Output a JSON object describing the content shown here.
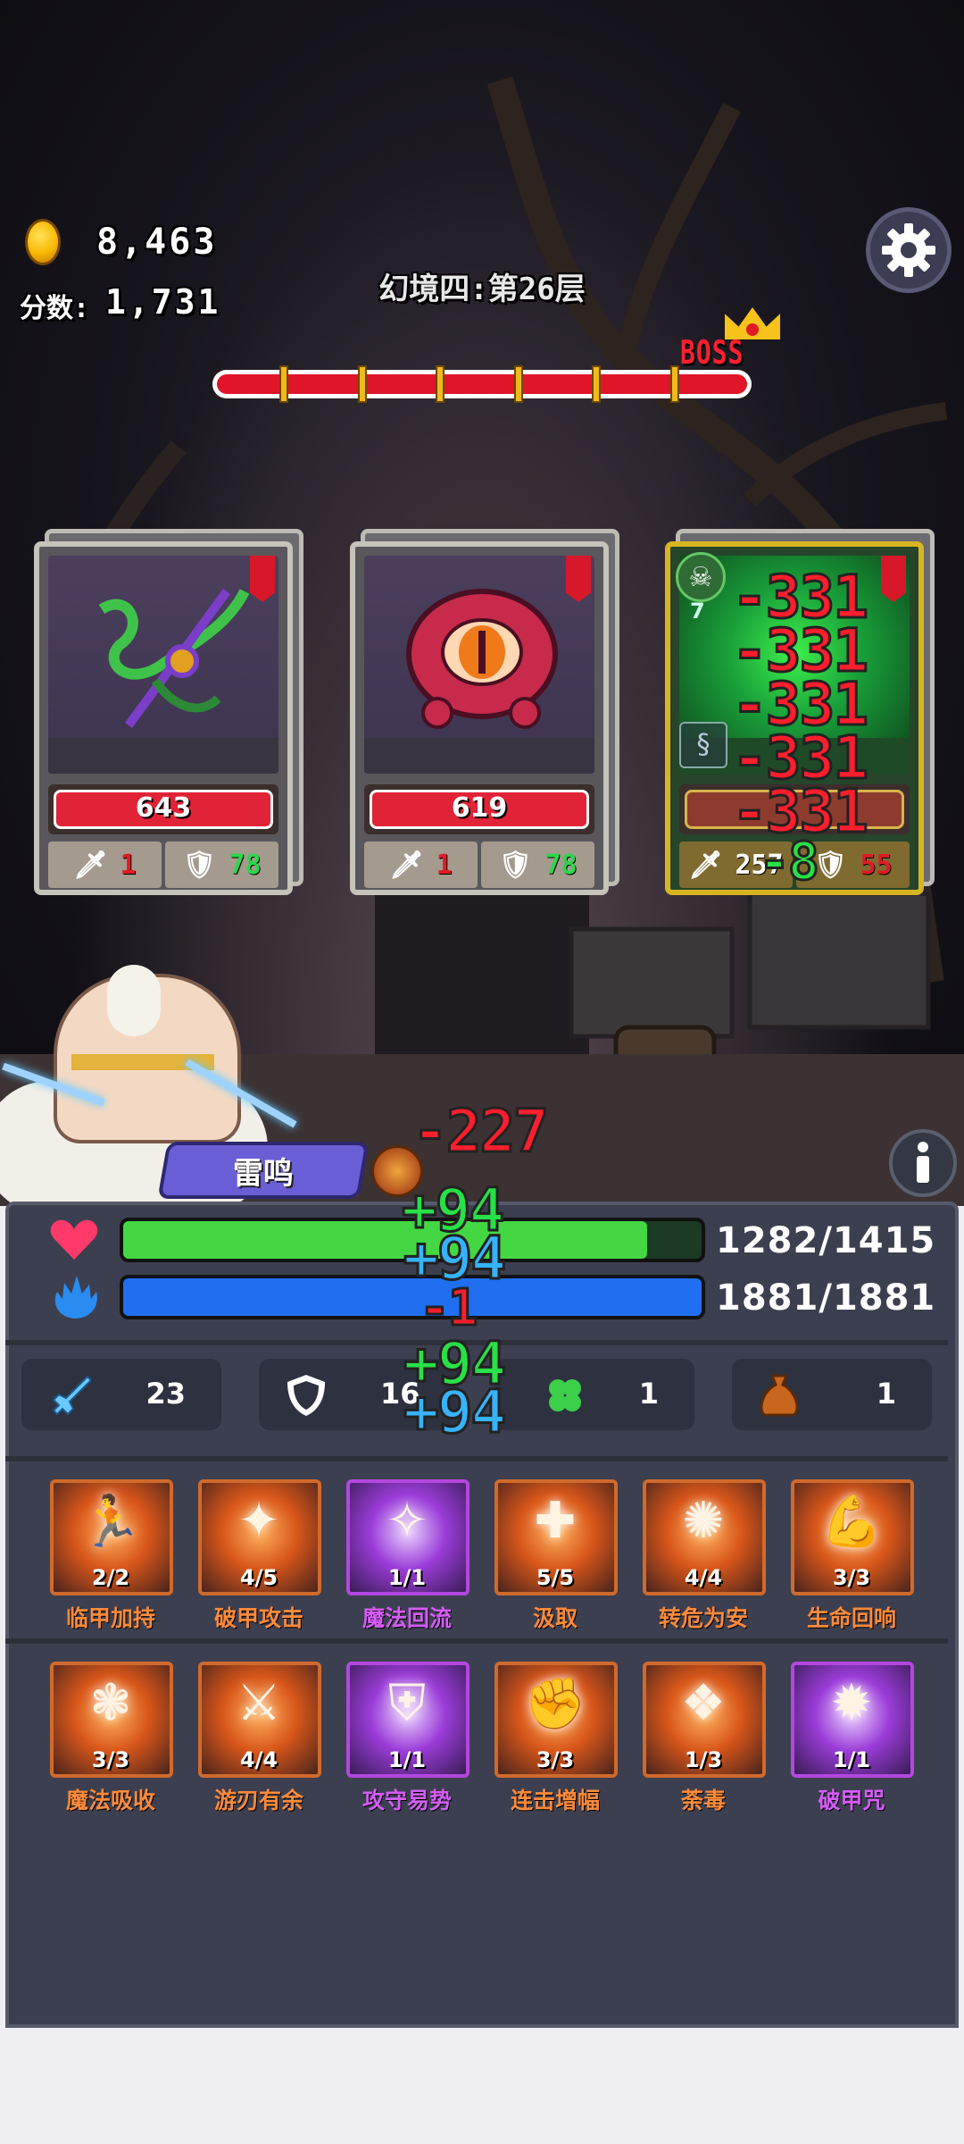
{
  "hud": {
    "gold": "8,463",
    "score_label": "分数:",
    "score": "1,731",
    "floor_title": "幻境四:第26层",
    "boss_label": "BOSS"
  },
  "enemies": [
    {
      "name": "thorn-vine",
      "hp": "643",
      "attack": "1",
      "defense": "78"
    },
    {
      "name": "red-eye",
      "hp": "619",
      "attack": "1",
      "defense": "78"
    },
    {
      "name": "poisoned-enemy",
      "hp": "",
      "attack": "257",
      "defense": "55",
      "poison_count": "7"
    }
  ],
  "hero": {
    "name": "雷鸣",
    "hp": "1282/1415",
    "hp_fraction": 0.906,
    "mp": "1881/1881",
    "mp_fraction": 1.0
  },
  "stats": {
    "attack": "23",
    "defense": "16",
    "luck": "1",
    "bag": "1"
  },
  "skills_row1": [
    {
      "name": "临甲加持",
      "count": "2/2",
      "style": "orange",
      "glyph": "🏃"
    },
    {
      "name": "破甲攻击",
      "count": "4/5",
      "style": "orange",
      "glyph": "✦"
    },
    {
      "name": "魔法回流",
      "count": "1/1",
      "style": "purple",
      "glyph": "✧"
    },
    {
      "name": "汲取",
      "count": "5/5",
      "style": "orange",
      "glyph": "✚"
    },
    {
      "name": "转危为安",
      "count": "4/4",
      "style": "orange",
      "glyph": "✺"
    },
    {
      "name": "生命回响",
      "count": "3/3",
      "style": "orange",
      "glyph": "💪"
    }
  ],
  "skills_row2": [
    {
      "name": "魔法吸收",
      "count": "3/3",
      "style": "orange",
      "glyph": "❃"
    },
    {
      "name": "游刃有余",
      "count": "4/4",
      "style": "orange",
      "glyph": "⚔"
    },
    {
      "name": "攻守易势",
      "count": "1/1",
      "style": "purple",
      "glyph": "⛨"
    },
    {
      "name": "连击增幅",
      "count": "3/3",
      "style": "orange",
      "glyph": "✊"
    },
    {
      "name": "荼毒",
      "count": "1/3",
      "style": "orange",
      "glyph": "❖"
    },
    {
      "name": "破甲咒",
      "count": "1/1",
      "style": "purple",
      "glyph": "✹"
    }
  ],
  "floating_numbers": {
    "enemy_damage": [
      "-331",
      "-331",
      "-331",
      "-331",
      "-331"
    ],
    "enemy_poison": "-8",
    "hero_damage": "-227",
    "hero_heals": [
      "+94",
      "+94",
      "+94",
      "+94"
    ],
    "hero_mana": "-1"
  },
  "colors": {
    "hp_green": "#43d843",
    "mp_blue": "#1f6ff0",
    "enemy_hp_red": "#e02336",
    "skill_orange": "#ff8a3a",
    "skill_purple": "#d55cf8"
  }
}
